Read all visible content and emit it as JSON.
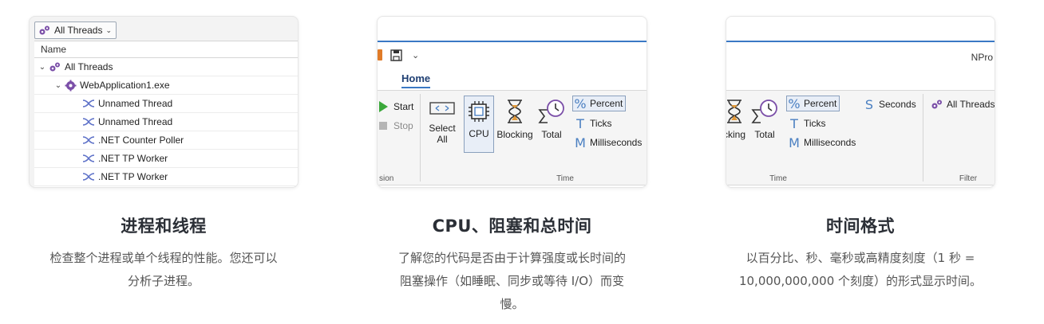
{
  "card1": {
    "dropdown_label": "All Threads",
    "column_header": "Name",
    "rows": [
      {
        "label": "All Threads",
        "indent": 0,
        "chevron": "⌄",
        "icon": "gear-threads-icon"
      },
      {
        "label": "WebApplication1.exe",
        "indent": 1,
        "chevron": "⌄",
        "icon": "gear-icon"
      },
      {
        "label": "Unnamed Thread",
        "indent": 2,
        "chevron": "",
        "icon": "thread-icon"
      },
      {
        "label": "Unnamed Thread",
        "indent": 2,
        "chevron": "",
        "icon": "thread-icon"
      },
      {
        "label": ".NET Counter Poller",
        "indent": 2,
        "chevron": "",
        "icon": "thread-icon"
      },
      {
        "label": ".NET TP Worker",
        "indent": 2,
        "chevron": "",
        "icon": "thread-icon"
      },
      {
        "label": ".NET TP Worker",
        "indent": 2,
        "chevron": "",
        "icon": "thread-icon"
      }
    ]
  },
  "card2": {
    "tab_home": "Home",
    "start": "Start",
    "stop": "Stop",
    "session_group": "sion",
    "select_all_1": "Select",
    "select_all_2": "All",
    "cpu": "CPU",
    "blocking": "Blocking",
    "total": "Total",
    "percent": "Percent",
    "ticks": "Ticks",
    "milliseconds": "Milliseconds",
    "time_group": "Time"
  },
  "card3": {
    "npro": "NPro",
    "blocking_partial": "cking",
    "total": "Total",
    "percent": "Percent",
    "ticks": "Ticks",
    "milliseconds": "Milliseconds",
    "seconds": "Seconds",
    "all_threads": "All Threads",
    "time_group": "Time",
    "filter_group": "Filter"
  },
  "features": [
    {
      "title": "进程和线程",
      "desc_1": "检查整个进程或单个线程的性能。您还可以",
      "desc_2": "分析子进程。",
      "desc_3": ""
    },
    {
      "title": "CPU、阻塞和总时间",
      "desc_1": "了解您的代码是否由于计算强度或长时间的",
      "desc_2": "阻塞操作（如睡眠、同步或等待 I/O）而变",
      "desc_3": "慢。"
    },
    {
      "title": "时间格式",
      "desc_1": "以百分比、秒、毫秒或高精度刻度（1 秒 =",
      "desc_2": "10,000,000,000 个刻度）的形式显示时间。",
      "desc_3": ""
    }
  ],
  "colors": {
    "accent_blue": "#3a78c4",
    "thread_icon": "#5b6fc7",
    "gear_purple": "#7b4fa8",
    "start_green": "#3aa83a"
  }
}
